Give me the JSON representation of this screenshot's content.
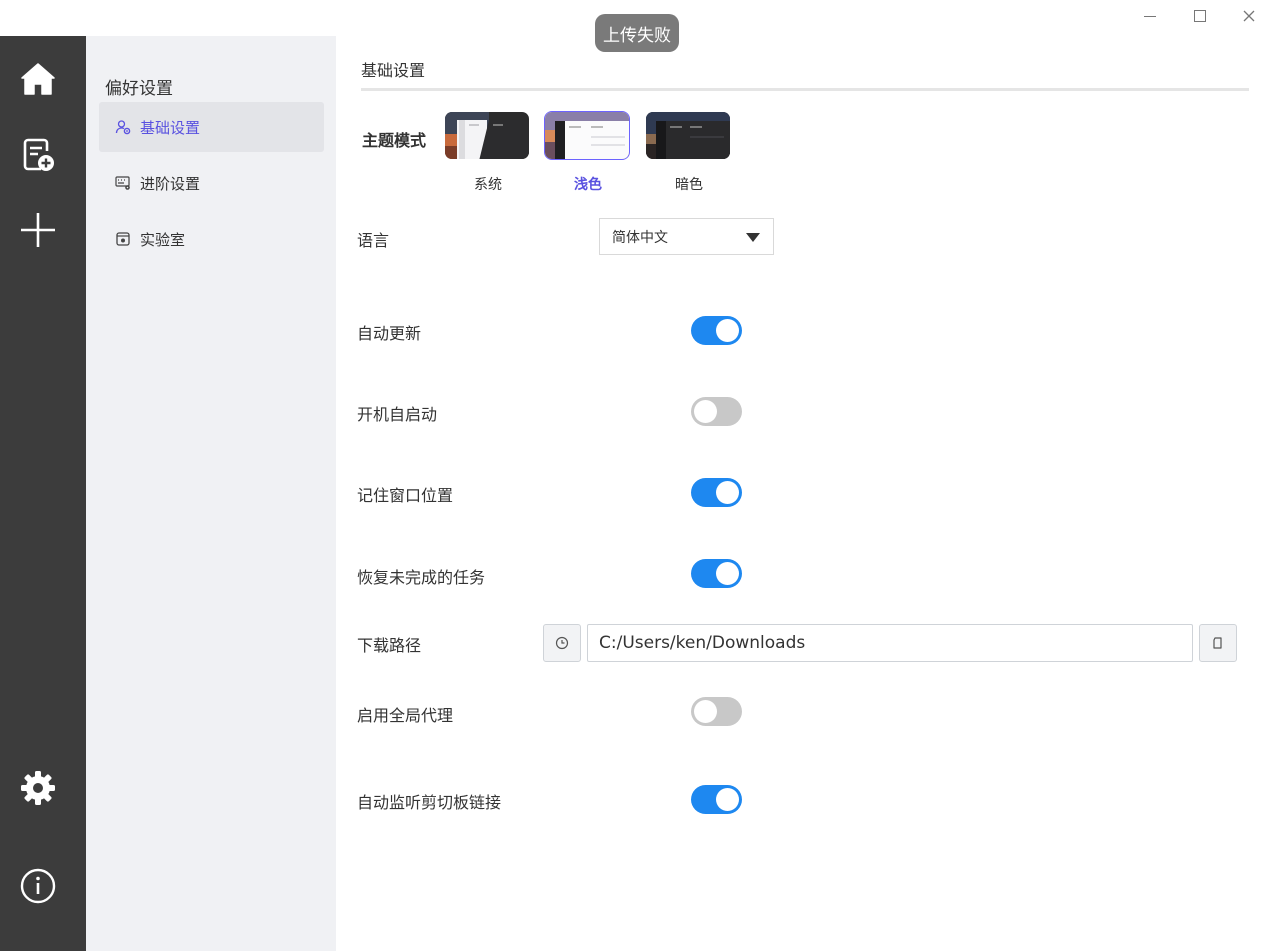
{
  "toast": {
    "text": "上传失败"
  },
  "window_controls": {
    "minimize": "minimize-icon",
    "maximize": "maximize-icon",
    "close": "close-icon"
  },
  "rail": {
    "items": [
      {
        "icon": "home-icon"
      },
      {
        "icon": "task-list-add-icon"
      },
      {
        "icon": "plus-icon"
      },
      {
        "icon": "gear-icon"
      },
      {
        "icon": "info-icon"
      }
    ]
  },
  "sidemenu": {
    "title": "偏好设置",
    "items": [
      {
        "label": "基础设置",
        "icon": "user-gear-icon",
        "active": true
      },
      {
        "label": "进阶设置",
        "icon": "keyboard-gear-icon",
        "active": false
      },
      {
        "label": "实验室",
        "icon": "lab-icon",
        "active": false
      }
    ]
  },
  "main": {
    "section_title": "基础设置",
    "theme": {
      "label": "主题模式",
      "options": [
        {
          "name": "系统",
          "selected": false
        },
        {
          "name": "浅色",
          "selected": true
        },
        {
          "name": "暗色",
          "selected": false
        }
      ]
    },
    "language": {
      "label": "语言",
      "value": "简体中文"
    },
    "settings": [
      {
        "label": "自动更新",
        "on": true
      },
      {
        "label": "开机自启动",
        "on": false
      },
      {
        "label": "记住窗口位置",
        "on": true
      },
      {
        "label": "恢复未完成的任务",
        "on": true
      }
    ],
    "download_path": {
      "label": "下载路径",
      "value": "C:/Users/ken/Downloads"
    },
    "proxy": {
      "label": "启用全局代理",
      "on": false
    },
    "clipboard": {
      "label": "自动监听剪切板链接",
      "on": true
    }
  },
  "colors": {
    "accent": "#5a52e0",
    "toggle_on": "#1e88f0",
    "toggle_off": "#c8c8c8",
    "rail_bg": "#3c3c3c",
    "sidemenu_bg": "#f0f1f4"
  }
}
